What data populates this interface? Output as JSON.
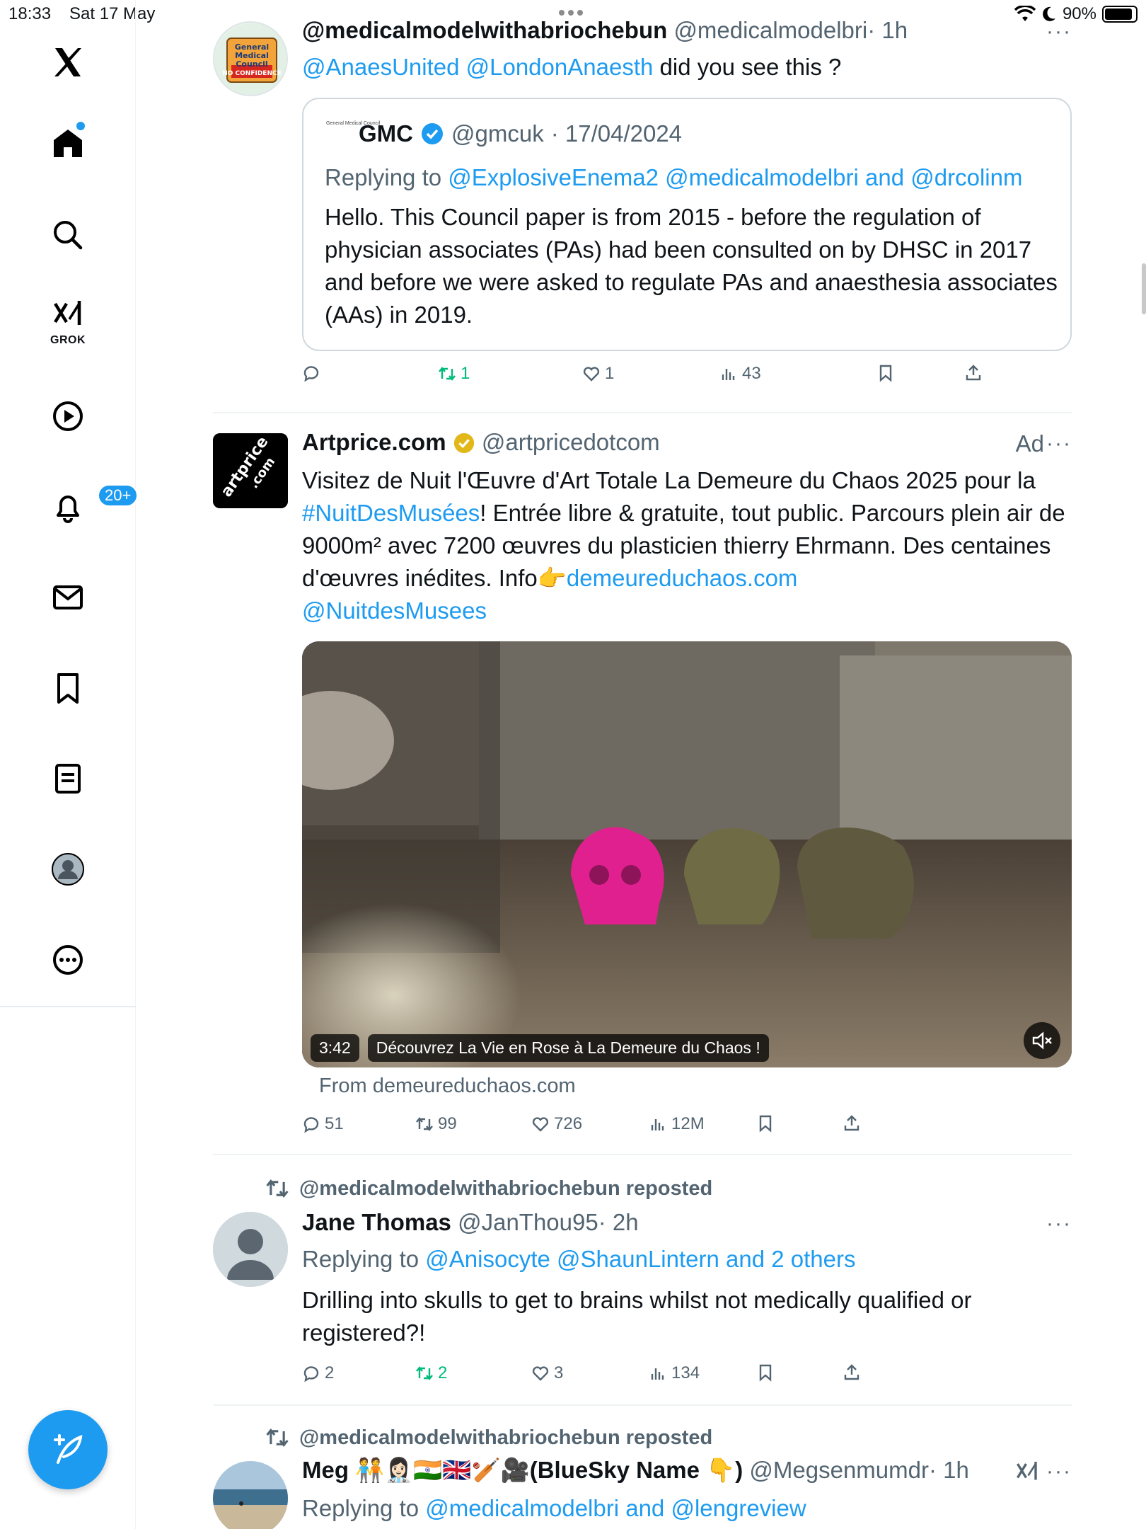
{
  "status_bar": {
    "time": "18:33",
    "date": "Sat 17 May",
    "battery": "90%",
    "battery_level": 0.9
  },
  "nav": {
    "grok_label": "GROK",
    "notifications_badge": "20+"
  },
  "colors": {
    "accent": "#1d9bf0",
    "repost_green": "#00ba7c",
    "secondary_text": "#536471",
    "gold_verified": "#e2b719"
  },
  "posts": [
    {
      "name": "@medicalmodelwithabriochebun",
      "handle": "@medicalmodelbri",
      "time": "· 1h",
      "mentions": "@AnaesUnited @LondonAnaesth",
      "text": "did you see this ?",
      "avatar_text": "General Medical Council NO CONFIDENCE",
      "quote": {
        "logo_text": "General Medical Council",
        "name": "GMC",
        "handle": "@gmcuk",
        "date": "· 17/04/2024",
        "replying_prefix": "Replying to",
        "replying_to": "@ExplosiveEnema2 @medicalmodelbri and @drcolinm",
        "text": "Hello. This Council paper is from 2015 - before the regulation of physician associates (PAs) had been consulted on by DHSC in 2017 and before we were asked to regulate PAs and anaesthesia associates (AAs) in 2019."
      },
      "stats": {
        "replies": "",
        "reposts": "1",
        "likes": "1",
        "views": "43"
      }
    },
    {
      "name": "Artprice.com",
      "handle": "@artpricedotcom",
      "ad_label": "Ad",
      "avatar_text": "artprice .com",
      "text_1": "Visitez de Nuit l'Œuvre d'Art Totale La Demeure du Chaos 2025 pour la",
      "hashtag": "#NuitDesMusées",
      "text_2": "! Entrée libre & gratuite, tout public. Parcours plein air de 9000m² avec 7200 œuvres du plasticien thierry Ehrmann. Des centaines d'œuvres inédites. Info👉",
      "link": "demeureduchaos.com",
      "mention": "@NuitdesMusees",
      "video": {
        "duration": "3:42",
        "title": "Découvrez La Vie en Rose à La Demeure du Chaos !"
      },
      "from": "From demeureduchaos.com",
      "stats": {
        "replies": "51",
        "reposts": "99",
        "likes": "726",
        "views": "12M"
      }
    },
    {
      "repost_by": "@medicalmodelwithabriochebun reposted",
      "name": "Jane Thomas",
      "handle": "@JanThou95",
      "time": "· 2h",
      "replying_prefix": "Replying to",
      "replying_to": "@Anisocyte @ShaunLintern and 2 others",
      "text": "Drilling into skulls to get to brains whilst not medically qualified or registered?!",
      "stats": {
        "replies": "2",
        "reposts": "2",
        "likes": "3",
        "views": "134"
      }
    },
    {
      "repost_by": "@medicalmodelwithabriochebun reposted",
      "name": "Meg 🧑‍🤝‍🧑👩🏻‍⚕️🇮🇳🇬🇧🏏🎥(BlueSky Name 👇)",
      "handle": "@Megsenmumdr",
      "time": "· 1h",
      "replying_prefix": "Replying to",
      "replying_to": "@medicalmodelbri and @lengreview"
    }
  ]
}
